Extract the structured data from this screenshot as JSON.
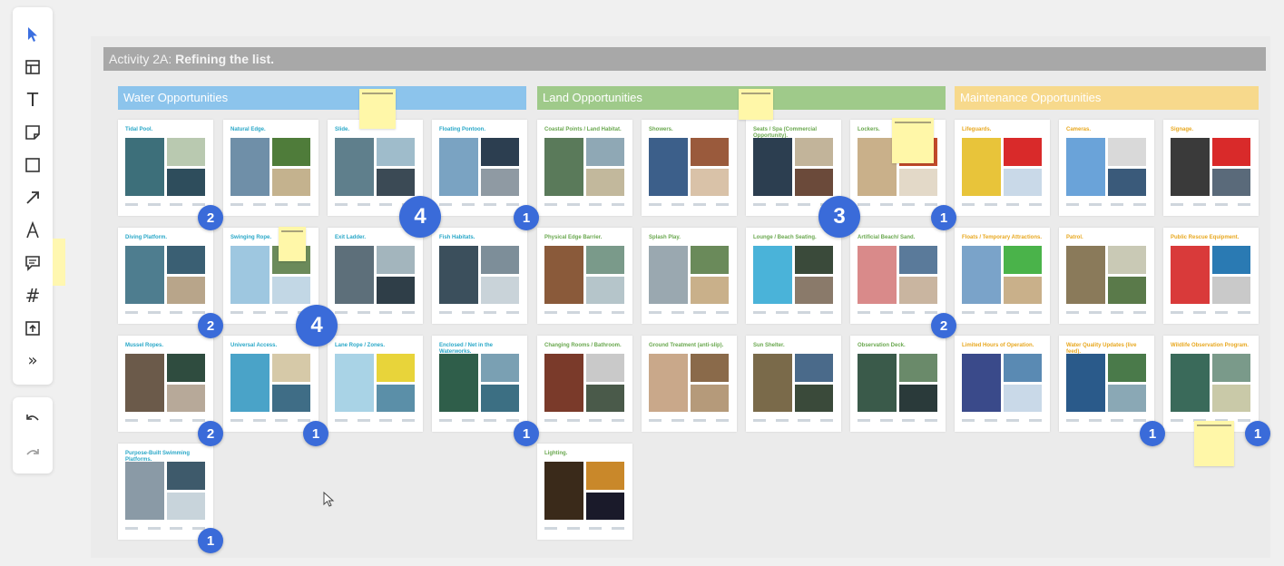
{
  "toolbar": {
    "tools": [
      {
        "name": "select-tool",
        "icon": "pointer-icon"
      },
      {
        "name": "template-tool",
        "icon": "template-icon"
      },
      {
        "name": "text-tool",
        "icon": "text-icon",
        "glyph": "T"
      },
      {
        "name": "sticky-note-tool",
        "icon": "sticky-note-icon"
      },
      {
        "name": "shape-tool",
        "icon": "rectangle-icon"
      },
      {
        "name": "connection-line-tool",
        "icon": "arrow-icon"
      },
      {
        "name": "pen-tool",
        "icon": "pen-icon"
      },
      {
        "name": "comment-tool",
        "icon": "comment-icon"
      },
      {
        "name": "frame-tool",
        "icon": "frame-icon",
        "glyph": "#"
      },
      {
        "name": "upload-tool",
        "icon": "upload-icon"
      },
      {
        "name": "more-tools",
        "icon": "more-icon",
        "glyph": "»"
      }
    ],
    "undo_icon": "undo-icon",
    "redo_icon": "redo-icon",
    "accent": "#3b6fe0"
  },
  "board": {
    "title_prefix": "Activity 2A:",
    "title_bold": "Refining the list.",
    "columns": [
      {
        "label": "Water Opportunities",
        "color": "#8cc4ec"
      },
      {
        "label": "Land Opportunities",
        "color": "#9fca8a"
      },
      {
        "label": "Maintenance Opportunities",
        "color": "#f7d98c"
      }
    ],
    "cards": [
      {
        "title": "Tidal Pool.",
        "color": "#2aa8c8"
      },
      {
        "title": "Natural Edge.",
        "color": "#2aa8c8"
      },
      {
        "title": "Slide.",
        "color": "#2aa8c8"
      },
      {
        "title": "Floating Pontoon.",
        "color": "#2aa8c8"
      },
      {
        "title": "Diving Platform.",
        "color": "#2aa8c8"
      },
      {
        "title": "Swinging Rope.",
        "color": "#2aa8c8"
      },
      {
        "title": "Exit Ladder.",
        "color": "#2aa8c8"
      },
      {
        "title": "Fish Habitats.",
        "color": "#2aa8c8"
      },
      {
        "title": "Mussel Ropes.",
        "color": "#2aa8c8"
      },
      {
        "title": "Universal Access.",
        "color": "#2aa8c8"
      },
      {
        "title": "Lane Rope / Zones.",
        "color": "#2aa8c8"
      },
      {
        "title": "Enclosed / Net in the Waterworks.",
        "color": "#2aa8c8"
      },
      {
        "title": "Purpose-Built Swimming Platforms.",
        "color": "#2aa8c8"
      },
      {
        "title": "Coastal Points / Land Habitat.",
        "color": "#6aa84f"
      },
      {
        "title": "Showers.",
        "color": "#6aa84f"
      },
      {
        "title": "Seats / Spa (Commercial Opportunity).",
        "color": "#6aa84f"
      },
      {
        "title": "Lockers.",
        "color": "#6aa84f"
      },
      {
        "title": "Physical Edge Barrier.",
        "color": "#6aa84f"
      },
      {
        "title": "Splash Play.",
        "color": "#6aa84f"
      },
      {
        "title": "Lounge / Beach Seating.",
        "color": "#6aa84f"
      },
      {
        "title": "Artificial Beach/ Sand.",
        "color": "#6aa84f"
      },
      {
        "title": "Changing Rooms / Bathroom.",
        "color": "#6aa84f"
      },
      {
        "title": "Ground Treatment (anti-slip).",
        "color": "#6aa84f"
      },
      {
        "title": "Sun Shelter.",
        "color": "#6aa84f"
      },
      {
        "title": "Observation Deck.",
        "color": "#6aa84f"
      },
      {
        "title": "Lighting.",
        "color": "#6aa84f"
      },
      {
        "title": "Lifeguards.",
        "color": "#e8a820"
      },
      {
        "title": "Cameras.",
        "color": "#e8a820"
      },
      {
        "title": "Signage.",
        "color": "#e8a820"
      },
      {
        "title": "Floats / Temporary Attractions.",
        "color": "#e8a820"
      },
      {
        "title": "Patrol.",
        "color": "#e8a820"
      },
      {
        "title": "Public Rescue Equipment.",
        "color": "#e8a820"
      },
      {
        "title": "Limited Hours of Operation.",
        "color": "#e8a820"
      },
      {
        "title": "Water Quality Updates (live feed).",
        "color": "#e8a820"
      },
      {
        "title": "Wildlife Observation Program.",
        "color": "#e8a820"
      }
    ],
    "votes": [
      "2",
      "4",
      "1",
      "3",
      "1",
      "2",
      "4",
      "2",
      "2",
      "1",
      "1",
      "1",
      "1",
      "1"
    ]
  }
}
